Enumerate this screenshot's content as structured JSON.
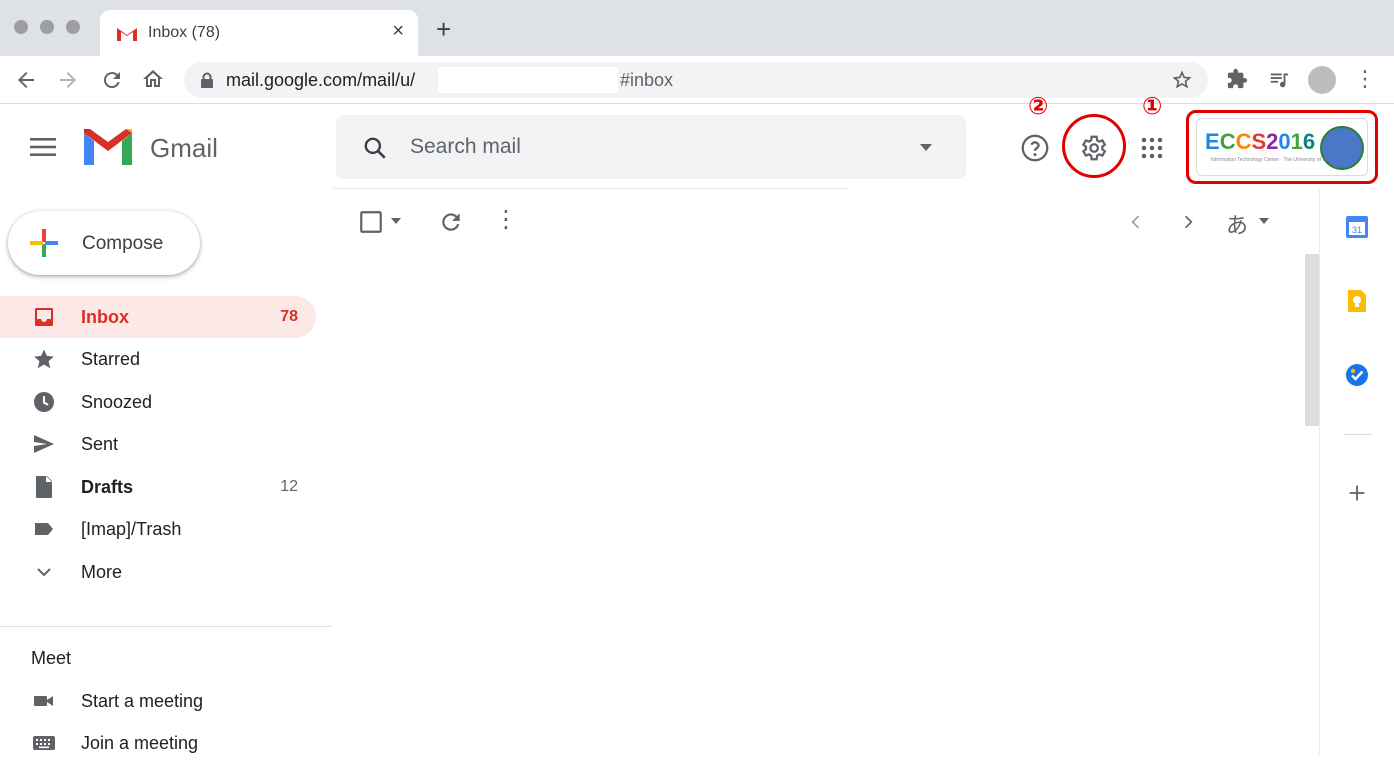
{
  "browser": {
    "tab_title": "Inbox (78)",
    "tab_close": "×",
    "new_tab": "+",
    "url_host": "mail.google.com/mail/u/",
    "url_hash": "#inbox"
  },
  "gmail": {
    "product_name": "Gmail",
    "search_placeholder": "Search mail",
    "compose_label": "Compose",
    "ime_label": "あ",
    "account_brand": "ECCS2016",
    "account_brand_sub": "Information Technology Center · The University of Tokyo"
  },
  "annotations": {
    "one": "①",
    "two": "②",
    "color": "#e00000"
  },
  "sidebar": {
    "items": [
      {
        "label": "Inbox",
        "count": "78",
        "icon": "inbox-icon",
        "active": true
      },
      {
        "label": "Starred",
        "count": "",
        "icon": "star-icon"
      },
      {
        "label": "Snoozed",
        "count": "",
        "icon": "clock-icon"
      },
      {
        "label": "Sent",
        "count": "",
        "icon": "send-icon"
      },
      {
        "label": "Drafts",
        "count": "12",
        "icon": "draft-icon"
      },
      {
        "label": "[Imap]/Trash",
        "count": "",
        "icon": "label-icon"
      },
      {
        "label": "More",
        "count": "",
        "icon": "chevron-down-icon"
      }
    ],
    "meet": {
      "title": "Meet",
      "start": "Start a meeting",
      "join": "Join a meeting"
    }
  },
  "side_panel": {
    "calendar_day": "31"
  },
  "colors": {
    "accent_red": "#d93025",
    "active_bg": "#fce8e6"
  }
}
